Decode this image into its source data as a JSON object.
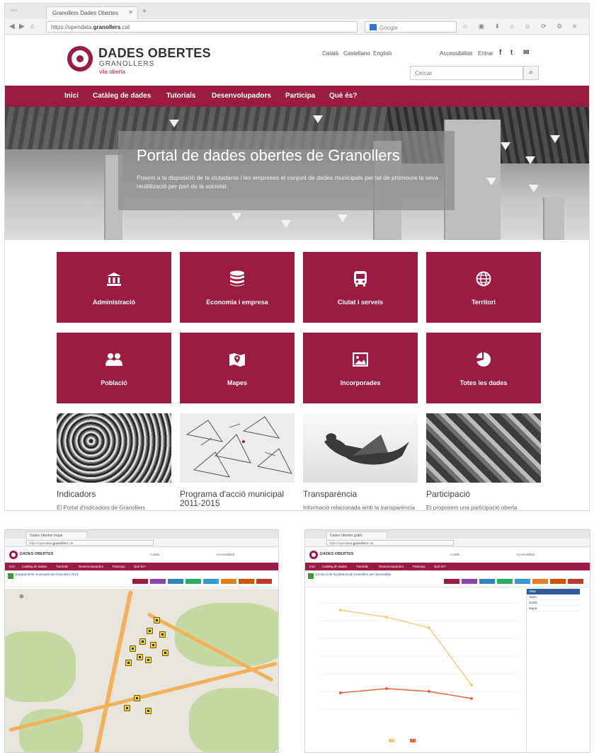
{
  "browser": {
    "tab_title": "Granollers Dades Obertes",
    "url_prefix": "https://opendata.",
    "url_domain": "granollers",
    "url_suffix": ".cat",
    "search_placeholder": "Google"
  },
  "site": {
    "logo_title": "DADES OBERTES",
    "logo_subtitle": "GRANOLLERS",
    "logo_tagline": "vila oberta",
    "languages": [
      "Català",
      "Castellano",
      "English"
    ],
    "access_label": "Accessibilitat",
    "login_label": "Entrar",
    "social": [
      "f",
      "t",
      "✉"
    ],
    "search_placeholder": "Cercar",
    "search_button": "⌕"
  },
  "nav": [
    "Inici",
    "Catàleg de dades",
    "Tutorials",
    "Desenvolupadors",
    "Participa",
    "Què és?"
  ],
  "hero": {
    "title": "Portal de dades obertes de Granollers",
    "text": "Posem a la disposició de la ciutadania i les empreses el conjunt de dades municipals per tal de promoure la seva reutilització per part de la societat."
  },
  "categories": [
    {
      "label": "Administració",
      "icon": "building-icon"
    },
    {
      "label": "Economia i empresa",
      "icon": "database-icon"
    },
    {
      "label": "Ciutat i serveis",
      "icon": "bus-icon"
    },
    {
      "label": "Territori",
      "icon": "globe-icon"
    },
    {
      "label": "Població",
      "icon": "people-icon"
    },
    {
      "label": "Mapes",
      "icon": "map-icon"
    },
    {
      "label": "Incorporades",
      "icon": "image-icon"
    },
    {
      "label": "Totes les dades",
      "icon": "pie-chart-icon"
    }
  ],
  "features": [
    {
      "title": "Indicadors",
      "desc": "El Portal d'indicadors de Granollers"
    },
    {
      "title": "Programa d'acció municipal 2011-2015",
      "desc": ""
    },
    {
      "title": "Transparència",
      "desc": "Informació relacionada amb la transparència"
    },
    {
      "title": "Participació",
      "desc": "Et proposem una participació oberta"
    }
  ],
  "mini_left": {
    "tab_title": "Dades obertes mapa",
    "doc_title": "Equipaments municipals de Granollers 2013"
  },
  "mini_right": {
    "tab_title": "Dades obertes gràfic",
    "doc_title": "Evolució de la població de Granollers per nacionalitat",
    "panel_head": "Vista",
    "panel_rows": [
      "Taula",
      "Gràfic",
      "Mapa"
    ]
  },
  "colors": {
    "brand": "#9b1b43",
    "nav_text": "#ffffff"
  }
}
